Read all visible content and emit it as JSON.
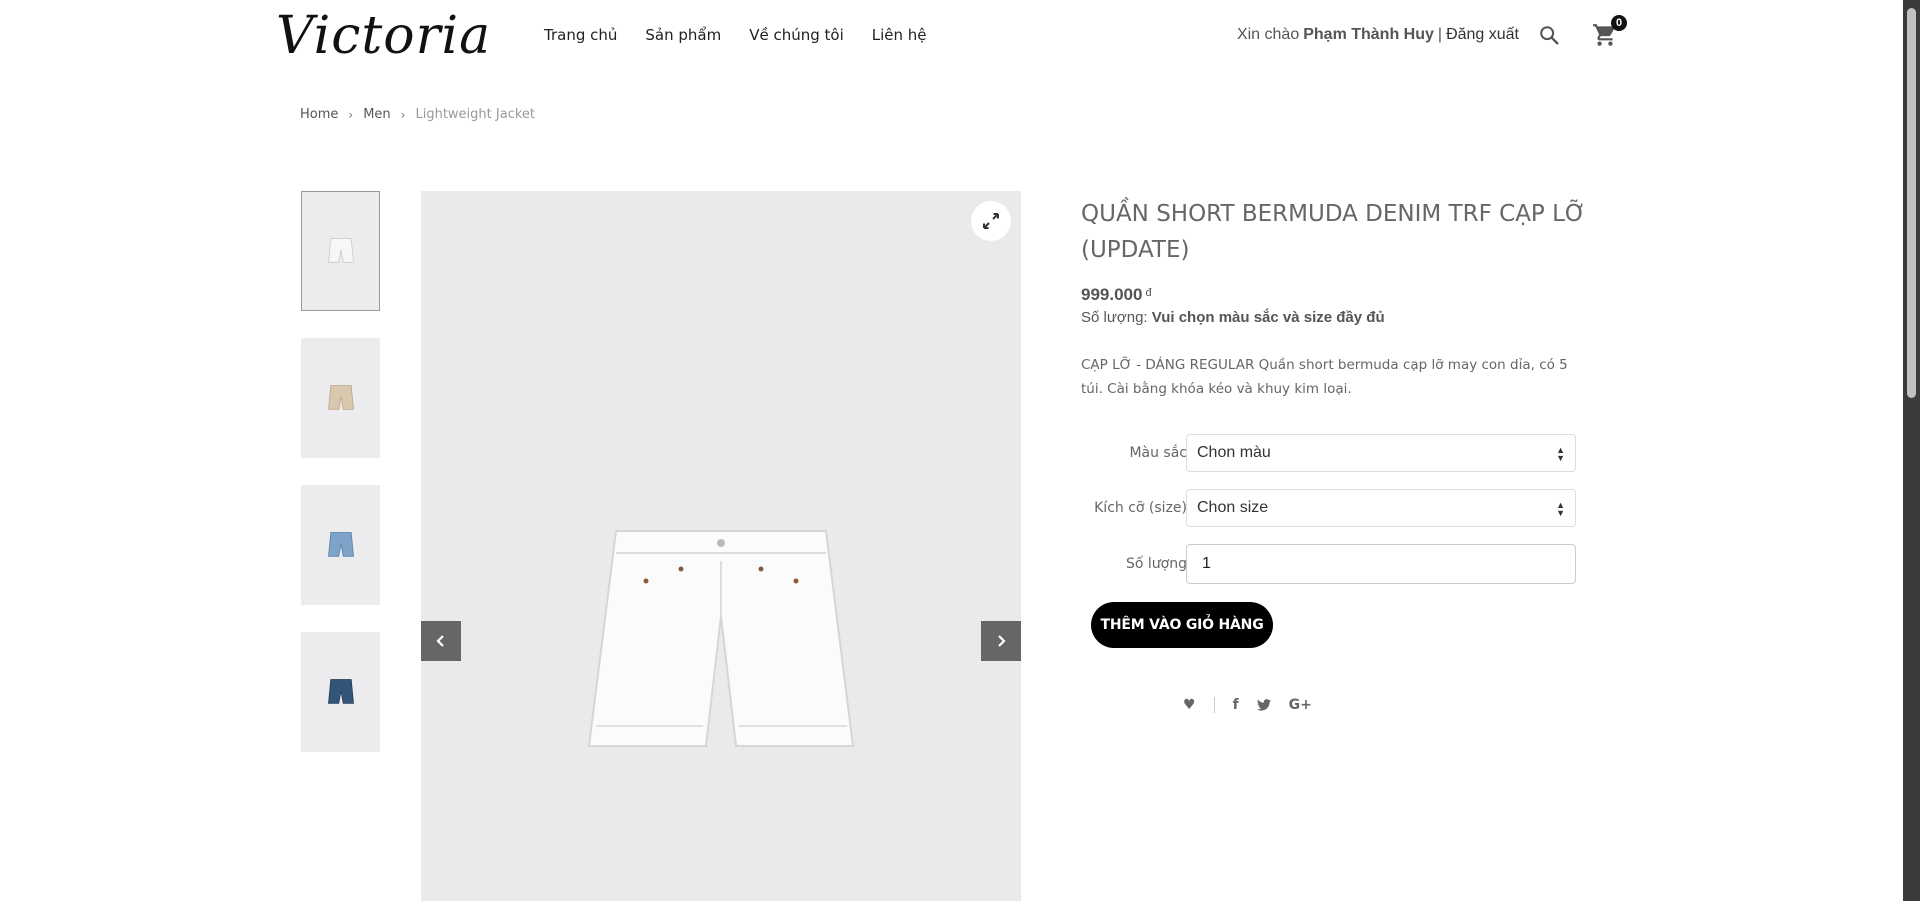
{
  "header": {
    "logo": "Victoria",
    "nav": [
      "Trang chủ",
      "Sản phẩm",
      "Về chúng tôi",
      "Liên hệ"
    ],
    "greeting": "Xin chào",
    "username": "Phạm Thành Huy",
    "separator": "|",
    "logout": "Đăng xuất",
    "cart_count": "0"
  },
  "breadcrumb": {
    "items": [
      "Home",
      "Men"
    ],
    "current": "Lightweight Jacket"
  },
  "gallery": {
    "thumbnail_colors": [
      "#f4f4f4",
      "#d9c7ae",
      "#7ea3c8",
      "#34557a"
    ]
  },
  "product": {
    "title": "QUẦN SHORT BERMUDA DENIM TRF CẠP LỠ (UPDATE)",
    "price": "999.000",
    "currency": "đ",
    "qty_label": "Số lượng:",
    "qty_note": "Vui chọn màu sắc và size đầy đủ",
    "description": "CẠP LỠ - DÁNG REGULAR Quần short bermuda cạp lỡ may con dỉa, có 5 túi. Cài bằng khóa kéo và khuy kim loại."
  },
  "form": {
    "color_label": "Màu sắc",
    "color_value": "Chon màu",
    "size_label": "Kích cỡ (size)",
    "size_value": "Chon size",
    "qty_label": "Số lượng",
    "qty_value": "1",
    "add_to_cart": "THÊM VÀO GIỎ HÀNG"
  },
  "social": {
    "facebook": "f",
    "google": "G+"
  }
}
